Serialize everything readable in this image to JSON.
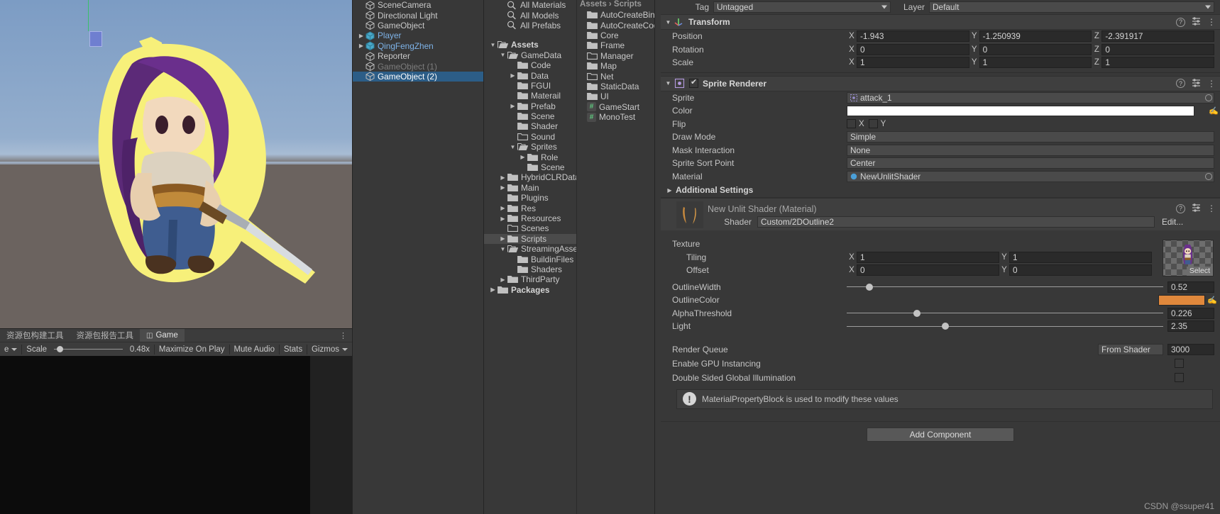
{
  "scene_view": {
    "tabs": [
      {
        "label": "资源包构建工具",
        "active": false,
        "icon": ""
      },
      {
        "label": "资源包报告工具",
        "active": false,
        "icon": ""
      },
      {
        "label": "Game",
        "active": true,
        "icon": "display-icon"
      }
    ],
    "kebab": "⋮",
    "toolbar": {
      "display_label": "e",
      "scale_label": "Scale",
      "scale_value": "0.48x",
      "maximize_on_play": "Maximize On Play",
      "mute_audio": "Mute Audio",
      "stats": "Stats",
      "gizmos": "Gizmos"
    }
  },
  "hierarchy": {
    "items": [
      {
        "label": "SceneCamera",
        "indent": 1,
        "arrow": "",
        "style": "normal"
      },
      {
        "label": "Directional Light",
        "indent": 1,
        "arrow": "",
        "style": "normal"
      },
      {
        "label": "GameObject",
        "indent": 1,
        "arrow": "",
        "style": "normal"
      },
      {
        "label": "Player",
        "indent": 1,
        "arrow": "▶",
        "style": "prefab"
      },
      {
        "label": "QingFengZhen",
        "indent": 1,
        "arrow": "▶",
        "style": "prefab"
      },
      {
        "label": "Reporter",
        "indent": 1,
        "arrow": "",
        "style": "normal"
      },
      {
        "label": "GameObject (1)",
        "indent": 1,
        "arrow": "",
        "style": "dim"
      },
      {
        "label": "GameObject (2)",
        "indent": 1,
        "arrow": "",
        "style": "selected"
      }
    ]
  },
  "project": {
    "searches": [
      {
        "label": "All Materials"
      },
      {
        "label": "All Models"
      },
      {
        "label": "All Prefabs"
      }
    ],
    "tree": [
      {
        "label": "Assets",
        "indent": 0,
        "arrow": "▼",
        "bold": true,
        "open": true,
        "selected": false
      },
      {
        "label": "GameData",
        "indent": 1,
        "arrow": "▼",
        "bold": false,
        "open": true,
        "selected": false
      },
      {
        "label": "Code",
        "indent": 2,
        "arrow": "",
        "bold": false,
        "open": false,
        "selected": false
      },
      {
        "label": "Data",
        "indent": 2,
        "arrow": "▶",
        "bold": false,
        "open": false,
        "selected": false
      },
      {
        "label": "FGUI",
        "indent": 2,
        "arrow": "",
        "bold": false,
        "open": false,
        "selected": false
      },
      {
        "label": "Materail",
        "indent": 2,
        "arrow": "",
        "bold": false,
        "open": false,
        "selected": false
      },
      {
        "label": "Prefab",
        "indent": 2,
        "arrow": "▶",
        "bold": false,
        "open": false,
        "selected": false
      },
      {
        "label": "Scene",
        "indent": 2,
        "arrow": "",
        "bold": false,
        "open": false,
        "selected": false
      },
      {
        "label": "Shader",
        "indent": 2,
        "arrow": "",
        "bold": false,
        "open": false,
        "selected": false
      },
      {
        "label": "Sound",
        "indent": 2,
        "arrow": "",
        "bold": false,
        "open": false,
        "selected": false,
        "empty": true
      },
      {
        "label": "Sprites",
        "indent": 2,
        "arrow": "▼",
        "bold": false,
        "open": true,
        "selected": false
      },
      {
        "label": "Role",
        "indent": 3,
        "arrow": "▶",
        "bold": false,
        "open": false,
        "selected": false
      },
      {
        "label": "Scene",
        "indent": 3,
        "arrow": "",
        "bold": false,
        "open": false,
        "selected": false
      },
      {
        "label": "HybridCLRData",
        "indent": 1,
        "arrow": "▶",
        "bold": false,
        "open": false,
        "selected": false
      },
      {
        "label": "Main",
        "indent": 1,
        "arrow": "▶",
        "bold": false,
        "open": false,
        "selected": false
      },
      {
        "label": "Plugins",
        "indent": 1,
        "arrow": "",
        "bold": false,
        "open": false,
        "selected": false
      },
      {
        "label": "Res",
        "indent": 1,
        "arrow": "▶",
        "bold": false,
        "open": false,
        "selected": false
      },
      {
        "label": "Resources",
        "indent": 1,
        "arrow": "▶",
        "bold": false,
        "open": false,
        "selected": false
      },
      {
        "label": "Scenes",
        "indent": 1,
        "arrow": "",
        "bold": false,
        "open": false,
        "selected": false,
        "empty": true
      },
      {
        "label": "Scripts",
        "indent": 1,
        "arrow": "▶",
        "bold": false,
        "open": false,
        "selected": true
      },
      {
        "label": "StreamingAssets",
        "indent": 1,
        "arrow": "▼",
        "bold": false,
        "open": true,
        "selected": false
      },
      {
        "label": "BuildinFiles",
        "indent": 2,
        "arrow": "",
        "bold": false,
        "open": false,
        "selected": false
      },
      {
        "label": "Shaders",
        "indent": 2,
        "arrow": "",
        "bold": false,
        "open": false,
        "selected": false
      },
      {
        "label": "ThirdParty",
        "indent": 1,
        "arrow": "▶",
        "bold": false,
        "open": false,
        "selected": false
      },
      {
        "label": "Packages",
        "indent": 0,
        "arrow": "▶",
        "bold": true,
        "open": false,
        "selected": false
      }
    ]
  },
  "assets_column": {
    "header": "Assets  ›  Scripts",
    "items": [
      {
        "label": "AutoCreateBind",
        "type": "folder"
      },
      {
        "label": "AutoCreateCod",
        "type": "folder"
      },
      {
        "label": "Core",
        "type": "folder"
      },
      {
        "label": "Frame",
        "type": "folder"
      },
      {
        "label": "Manager",
        "type": "folder-empty"
      },
      {
        "label": "Map",
        "type": "folder"
      },
      {
        "label": "Net",
        "type": "folder-empty"
      },
      {
        "label": "StaticData",
        "type": "folder"
      },
      {
        "label": "UI",
        "type": "folder"
      },
      {
        "label": "GameStart",
        "type": "script"
      },
      {
        "label": "MonoTest",
        "type": "script"
      }
    ]
  },
  "inspector": {
    "tag_label": "Tag",
    "tag_value": "Untagged",
    "layer_label": "Layer",
    "layer_value": "Default",
    "transform": {
      "title": "Transform",
      "rows": [
        {
          "label": "Position",
          "x": "-1.943",
          "y": "-1.250939",
          "z": "-2.391917"
        },
        {
          "label": "Rotation",
          "x": "0",
          "y": "0",
          "z": "0"
        },
        {
          "label": "Scale",
          "x": "1",
          "y": "1",
          "z": "1"
        }
      ]
    },
    "sprite_renderer": {
      "title": "Sprite Renderer",
      "enabled": true,
      "sprite_label": "Sprite",
      "sprite_value": "attack_1",
      "color_label": "Color",
      "color_value": "#FFFFFF",
      "flip_label": "Flip",
      "flip_x_label": "X",
      "flip_y_label": "Y",
      "flip_x": false,
      "flip_y": false,
      "draw_mode_label": "Draw Mode",
      "draw_mode_value": "Simple",
      "mask_interaction_label": "Mask Interaction",
      "mask_interaction_value": "None",
      "sprite_sort_point_label": "Sprite Sort Point",
      "sprite_sort_point_value": "Center",
      "material_label": "Material",
      "material_value": "NewUnlitShader",
      "additional_settings": "Additional Settings"
    },
    "material": {
      "title": "New Unlit Shader (Material)",
      "shader_label": "Shader",
      "shader_value": "Custom/2DOutline2",
      "edit_button": "Edit...",
      "texture_label": "Texture",
      "texture_select_label": "Select",
      "tiling_label": "Tiling",
      "tiling_x": "1",
      "tiling_y": "1",
      "offset_label": "Offset",
      "offset_x": "0",
      "offset_y": "0",
      "axis_x": "X",
      "axis_y": "Y",
      "sliders": [
        {
          "label": "OutlineWidth",
          "value": "0.52",
          "pct": 6
        },
        {
          "label": "AlphaThreshold",
          "value": "0.226",
          "pct": 21
        },
        {
          "label": "Light",
          "value": "2.35",
          "pct": 30
        }
      ],
      "outline_color_label": "OutlineColor",
      "outline_color_value": "#E0883C",
      "render_queue_label": "Render Queue",
      "render_queue_mode": "From Shader",
      "render_queue_value": "3000",
      "gpu_instancing_label": "Enable GPU Instancing",
      "gpu_instancing": false,
      "double_sided_label": "Double Sided Global Illumination",
      "double_sided": false,
      "warning": "MaterialPropertyBlock is used to modify these values"
    },
    "add_component": "Add Component"
  },
  "watermark": "CSDN @ssuper41"
}
